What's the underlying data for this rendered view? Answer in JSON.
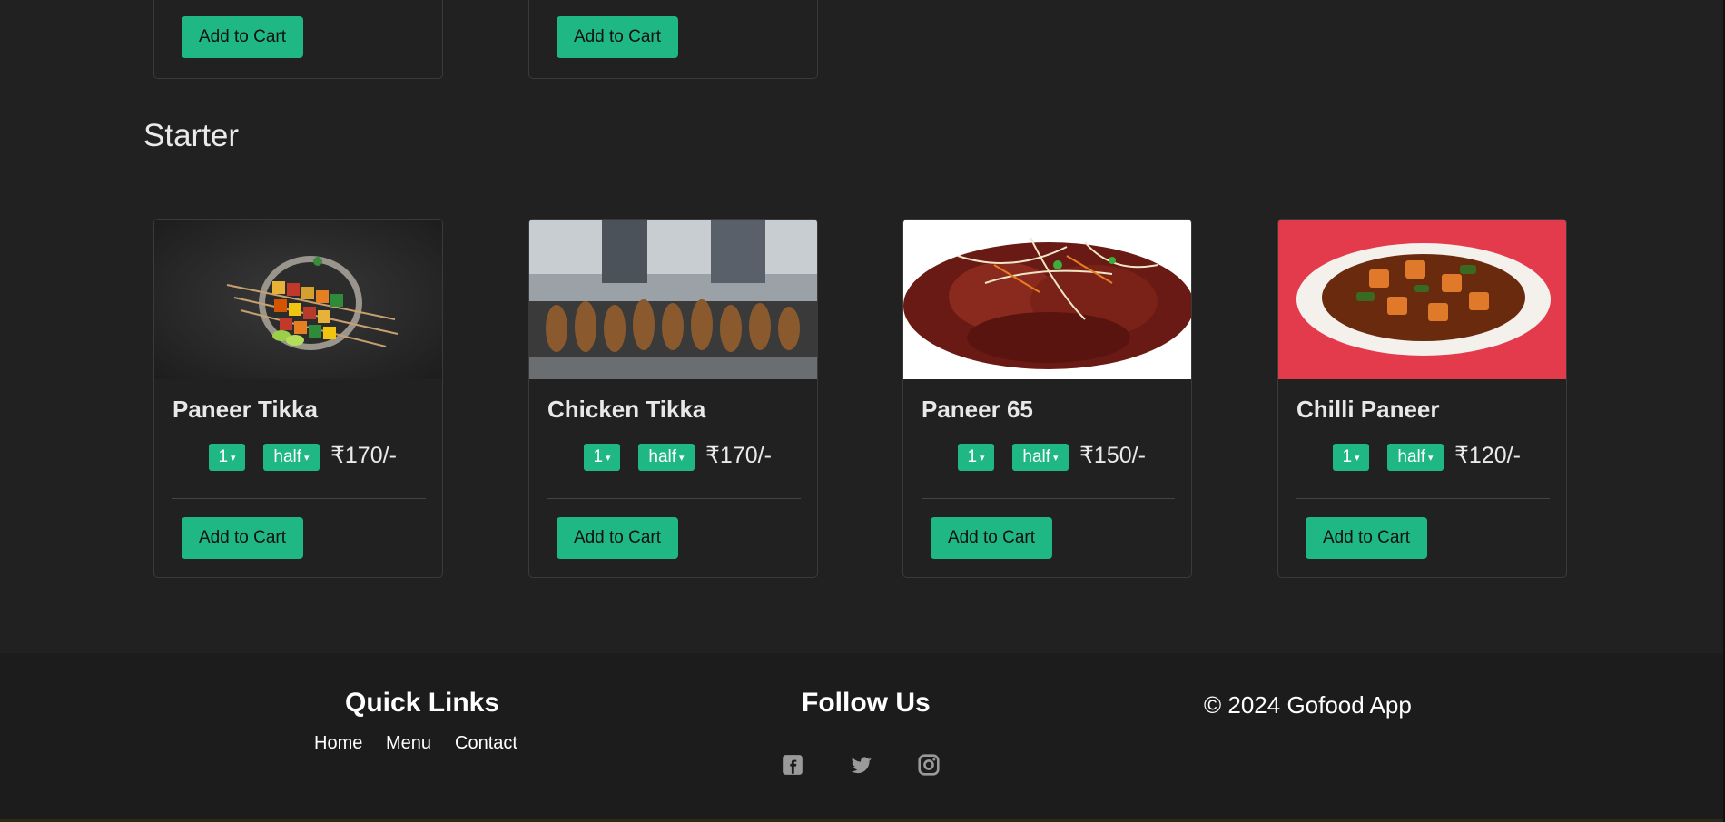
{
  "top_cards": [
    {
      "button_label": "Add to Cart"
    },
    {
      "button_label": "Add to Cart"
    }
  ],
  "section": {
    "title": "Starter"
  },
  "items": [
    {
      "name": "Paneer Tikka",
      "qty": "1",
      "size": "half",
      "price": "₹170/-",
      "button_label": "Add to Cart",
      "image": "paneer-tikka-photo"
    },
    {
      "name": "Chicken Tikka",
      "qty": "1",
      "size": "half",
      "price": "₹170/-",
      "button_label": "Add to Cart",
      "image": "chicken-tikka-photo"
    },
    {
      "name": "Paneer 65",
      "qty": "1",
      "size": "half",
      "price": "₹150/-",
      "button_label": "Add to Cart",
      "image": "paneer-65-photo"
    },
    {
      "name": "Chilli Paneer",
      "qty": "1",
      "size": "half",
      "price": "₹120/-",
      "button_label": "Add to Cart",
      "image": "chilli-paneer-photo"
    }
  ],
  "footer": {
    "quick_links_title": "Quick Links",
    "links": [
      "Home",
      "Menu",
      "Contact"
    ],
    "follow_title": "Follow Us",
    "social": [
      "facebook-icon",
      "twitter-icon",
      "instagram-icon"
    ],
    "copyright": "© 2024 Gofood App"
  },
  "colors": {
    "accent": "#1fb783",
    "background": "#212121",
    "footer": "#1c1c1c"
  }
}
